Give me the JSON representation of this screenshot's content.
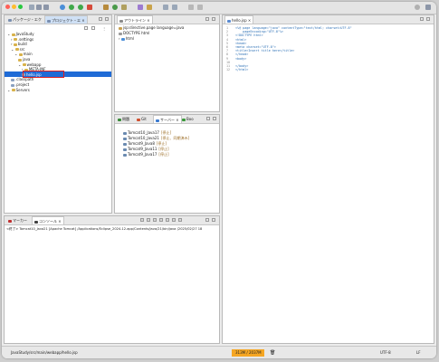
{
  "colors": {
    "accent": "#3b7fd6",
    "selection": "#1f6bd6",
    "highlight_box": "#e02020",
    "status_orange": "#f5a623"
  },
  "left_tabs": {
    "package": "パッケージ・エク",
    "project": "プロジェクト・エ"
  },
  "tree": [
    {
      "label": "JavaStudy",
      "depth": 0
    },
    {
      "label": ".settings",
      "depth": 1
    },
    {
      "label": "build",
      "depth": 1
    },
    {
      "label": "src",
      "depth": 1
    },
    {
      "label": "main",
      "depth": 2
    },
    {
      "label": "java",
      "depth": 3
    },
    {
      "label": "webapp",
      "depth": 3
    },
    {
      "label": "META-INF",
      "depth": 4
    },
    {
      "label": "hello.jsp",
      "depth": 4
    },
    {
      "label": ".classpath",
      "depth": 1
    },
    {
      "label": ".project",
      "depth": 1
    },
    {
      "label": "Servers",
      "depth": 0
    }
  ],
  "outline": {
    "tab": "アウトライン",
    "items": [
      "jsp:directive.page language=java",
      "DOCTYPE html",
      "html"
    ]
  },
  "servers": {
    "tabs": [
      "問題",
      "Git",
      "サーバー",
      "Boo"
    ],
    "items": [
      {
        "name": "Tomcat10_Java17",
        "state": "[停止]"
      },
      {
        "name": "Tomcat10_Java21",
        "state": "[停止、同期済み]"
      },
      {
        "name": "Tomcat9_Java8",
        "state": "[停止]"
      },
      {
        "name": "Tomcat9_Java11",
        "state": "[停止]"
      },
      {
        "name": "Tomcat9_Java17",
        "state": "[停止]"
      }
    ]
  },
  "console": {
    "tabs": [
      "マーカー",
      "コンソール"
    ],
    "line": "<終了> Tomcat10_Java21 [Apache Tomcat] /Applications/Eclipse_2024-12.app/Contents/java/21/bin/java (2025/02/27 18"
  },
  "editor": {
    "tab": "hello.jsp",
    "lines": [
      {
        "n": "1",
        "t": "<%@ page language=\"java\" contentType=\"text/html; charset=UTF-8\""
      },
      {
        "n": "2",
        "t": "    pageEncoding=\"UTF-8\"%>"
      },
      {
        "n": "3",
        "t": "<!DOCTYPE html>"
      },
      {
        "n": "4",
        "t": "<html>"
      },
      {
        "n": "5",
        "t": "<head>"
      },
      {
        "n": "6",
        "t": "<meta charset=\"UTF-8\">"
      },
      {
        "n": "7",
        "t": "<title>Insert title here</title>"
      },
      {
        "n": "8",
        "t": "</head>"
      },
      {
        "n": "9",
        "t": "<body>"
      },
      {
        "n": "10",
        "t": ""
      },
      {
        "n": "11",
        "t": "</body>"
      },
      {
        "n": "12",
        "t": "</html>"
      }
    ]
  },
  "status": {
    "path": "JavaStudy/src/main/webapp/hello.jsp",
    "memory": "313M / 2037M",
    "encoding": "UTF-8",
    "line_endings": "LF"
  }
}
